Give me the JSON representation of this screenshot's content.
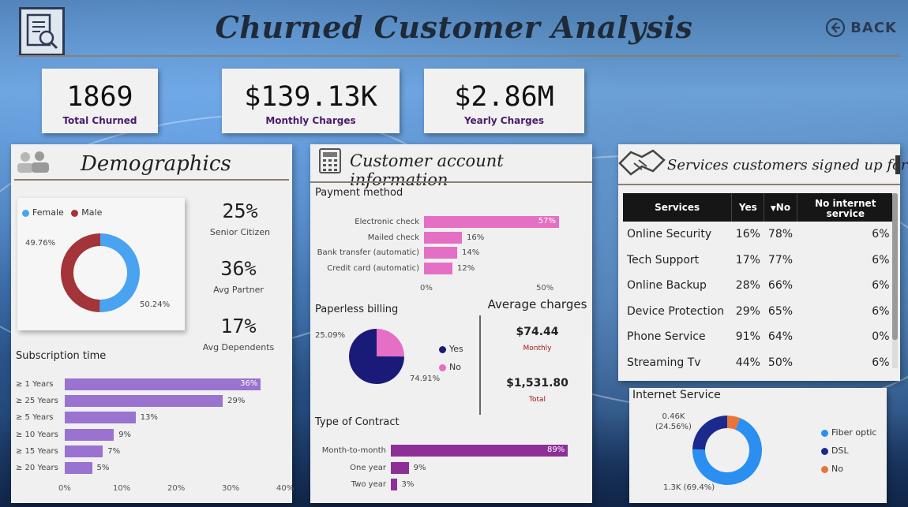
{
  "header": {
    "title": "Churned Customer Analysis",
    "back_label": "BACK"
  },
  "kpis": [
    {
      "value": "1869",
      "label": "Total Churned"
    },
    {
      "value": "$139.13K",
      "label": "Monthly Charges"
    },
    {
      "value": "$2.86M",
      "label": "Yearly Charges"
    }
  ],
  "demographics": {
    "title": "Demographics",
    "gender_legend": [
      "Female",
      "Male"
    ],
    "gender": {
      "female_pct": 50.24,
      "male_pct": 49.76,
      "female_label": "50.24%",
      "male_label": "49.76%"
    },
    "stats": [
      {
        "value": "25%",
        "label": "Senior Citizen"
      },
      {
        "value": "36%",
        "label": "Avg Partner"
      },
      {
        "value": "17%",
        "label": "Avg Dependents"
      }
    ],
    "subscription_title": "Subscription time",
    "subscription": [
      {
        "label": "≥ 1 Years",
        "value": 36,
        "text": "36%"
      },
      {
        "label": "≥ 25 Years",
        "value": 29,
        "text": "29%"
      },
      {
        "label": "≥ 5 Years",
        "value": 13,
        "text": "13%"
      },
      {
        "label": "≥ 10 Years",
        "value": 9,
        "text": "9%"
      },
      {
        "label": "≥ 15 Years",
        "value": 7,
        "text": "7%"
      },
      {
        "label": "≥ 20 Years",
        "value": 5,
        "text": "5%"
      }
    ],
    "subscription_ticks": [
      "0%",
      "10%",
      "20%",
      "30%",
      "40%"
    ]
  },
  "account": {
    "title": "Customer account information",
    "payment_title": "Payment method",
    "payment": [
      {
        "label": "Electronic check",
        "value": 57,
        "text": "57%"
      },
      {
        "label": "Mailed check",
        "value": 16,
        "text": "16%"
      },
      {
        "label": "Bank transfer (automatic)",
        "value": 14,
        "text": "14%"
      },
      {
        "label": "Credit card (automatic)",
        "value": 12,
        "text": "12%"
      }
    ],
    "payment_ticks": [
      "0%",
      "50%"
    ],
    "paperless_title": "Paperless billing",
    "paperless": {
      "yes_pct": 74.91,
      "no_pct": 25.09,
      "yes_label": "74.91%",
      "no_label": "25.09%"
    },
    "paperless_legend": [
      "Yes",
      "No"
    ],
    "avg_title": "Average charges",
    "avg_monthly_value": "$74.44",
    "avg_monthly_label": "Monthly",
    "avg_total_value": "$1,531.80",
    "avg_total_label": "Total",
    "contract_title": "Type of Contract",
    "contract": [
      {
        "label": "Month-to-month",
        "value": 89,
        "text": "89%"
      },
      {
        "label": "One year",
        "value": 9,
        "text": "9%"
      },
      {
        "label": "Two year",
        "value": 3,
        "text": "3%"
      }
    ]
  },
  "services": {
    "title": "Services customers signed up for",
    "columns": [
      "Services",
      "Yes",
      "No",
      "No internet service"
    ],
    "rows": [
      [
        "Online Security",
        "16%",
        "78%",
        "6%"
      ],
      [
        "Tech Support",
        "17%",
        "77%",
        "6%"
      ],
      [
        "Online Backup",
        "28%",
        "66%",
        "6%"
      ],
      [
        "Device Protection",
        "29%",
        "65%",
        "6%"
      ],
      [
        "Phone Service",
        "91%",
        "64%",
        "0%"
      ],
      [
        "Streaming Tv",
        "44%",
        "50%",
        "6%"
      ]
    ]
  },
  "internet": {
    "title": "Internet Service",
    "legend": [
      "Fiber optic",
      "DSL",
      "No"
    ],
    "slices": [
      {
        "name": "Fiber optic",
        "value": 69.4
      },
      {
        "name": "DSL",
        "value": 24.56
      },
      {
        "name": "No",
        "value": 6.04
      }
    ],
    "label_dsl": "0.46K\n(24.56%)",
    "label_dsl_1": "0.46K",
    "label_dsl_2": "(24.56%)",
    "label_fiber": "1.3K (69.4%)"
  },
  "colors": {
    "female": "#4aa3f0",
    "male": "#a2343a",
    "bar_purple": "#9a72cf",
    "bar_pink": "#e56fc5",
    "bar_violet": "#8e2f98",
    "pie_yes": "#1a1a78",
    "pie_no": "#e56fc5",
    "fiber": "#2a8ff0",
    "dsl": "#1b2a8c",
    "no_internet": "#e8743b"
  }
}
